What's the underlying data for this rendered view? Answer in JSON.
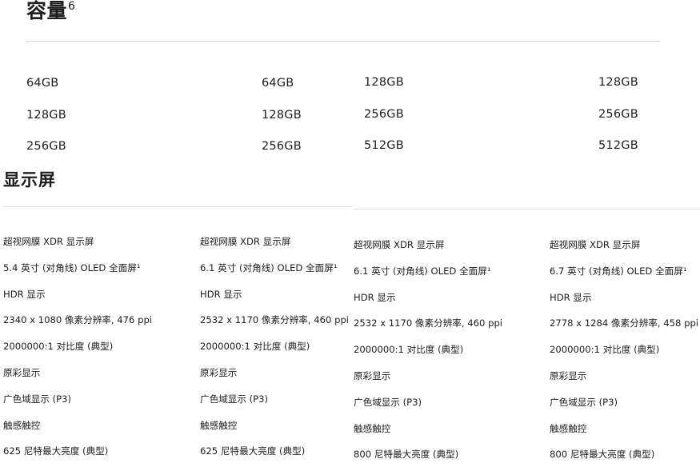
{
  "capacity": {
    "title": "容量",
    "footnote": "6",
    "columns": [
      [
        "64GB",
        "128GB",
        "256GB"
      ],
      [
        "64GB",
        "128GB",
        "256GB"
      ],
      [
        "128GB",
        "256GB",
        "512GB"
      ],
      [
        "128GB",
        "256GB",
        "512GB"
      ]
    ]
  },
  "display": {
    "title": "显示屏",
    "columns": [
      [
        "超视网膜 XDR 显示屏",
        "5.4 英寸 (对角线) OLED 全面屏¹",
        "HDR 显示",
        "2340 x 1080 像素分辨率, 476 ppi",
        "2000000:1 对比度 (典型)",
        "原彩显示",
        "广色域显示 (P3)",
        "触感触控",
        "625 尼特最大亮度 (典型)"
      ],
      [
        "超视网膜 XDR 显示屏",
        "6.1 英寸 (对角线) OLED 全面屏¹",
        "HDR 显示",
        "2532 x 1170 像素分辨率, 460 ppi",
        "2000000:1 对比度 (典型)",
        "原彩显示",
        "广色域显示 (P3)",
        "触感触控",
        "625 尼特最大亮度 (典型)"
      ],
      [
        "超视网膜 XDR 显示屏",
        "6.1 英寸 (对角线) OLED 全面屏¹",
        "HDR 显示",
        "2532 x 1170 像素分辨率, 460 ppi",
        "2000000:1 对比度 (典型)",
        "原彩显示",
        "广色域显示 (P3)",
        "触感触控",
        "800 尼特最大亮度 (典型)"
      ],
      [
        "超视网膜 XDR 显示屏",
        "6.7 英寸 (对角线) OLED 全面屏¹",
        "HDR 显示",
        "2778 x 1284 像素分辨率, 458 ppi",
        "2000000:1 对比度 (典型)",
        "原彩显示",
        "广色域显示 (P3)",
        "触感触控",
        "800 尼特最大亮度 (典型)"
      ]
    ]
  }
}
